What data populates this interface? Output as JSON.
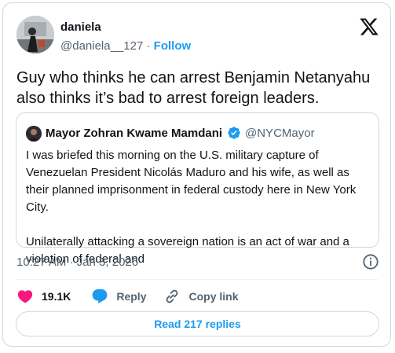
{
  "post": {
    "author_name": "daniela",
    "author_handle": "@daniela__127",
    "separator": "·",
    "follow_label": "Follow",
    "text": "Guy who thinks he can arrest Benjamin Netanyahu also thinks it’s bad to arrest foreign leaders.",
    "timestamp": "10:27 AM · Jan 3, 2026"
  },
  "quoted_post": {
    "author_name": "Mayor Zohran Kwame Mamdani",
    "author_handle": "@NYCMayor",
    "paragraph_1": "I was briefed this morning on the U.S. military capture of Venezuelan President Nicolás Maduro and his wife, as well as their planned imprisonment in federal custody here in New York City.",
    "paragraph_2": "Unilaterally attacking a sovereign nation is an act of war and a violation of federal and"
  },
  "actions": {
    "like_count": "19.1K",
    "reply_label": "Reply",
    "copy_link_label": "Copy link"
  },
  "read_replies_label": "Read 217 replies",
  "icons": {
    "brand": "x-logo-icon",
    "verified": "verified-badge-icon",
    "like": "heart-icon",
    "reply": "speech-bubble-icon",
    "copy_link": "link-icon",
    "info": "info-icon"
  },
  "colors": {
    "accent": "#1d9bf0",
    "like": "#f91880",
    "text": "#0f1419",
    "secondary": "#536471",
    "border": "#cfd9de"
  }
}
